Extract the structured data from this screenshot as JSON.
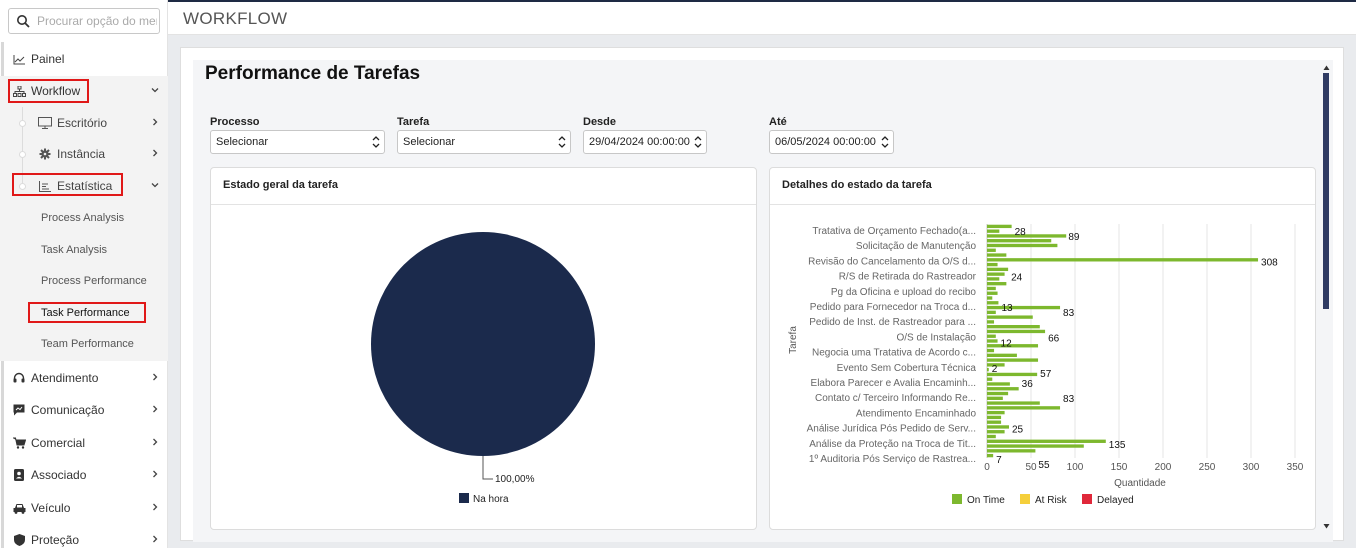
{
  "search": {
    "placeholder": "Procurar opção do menu"
  },
  "sidebar": {
    "painel": "Painel",
    "workflow": "Workflow",
    "escritorio": "Escritório",
    "instancia": "Instância",
    "estatistica": "Estatística",
    "leaves": [
      "Process Analysis",
      "Task Analysis",
      "Process Performance",
      "Task Performance",
      "Team Performance"
    ],
    "atendimento": "Atendimento",
    "comunicacao": "Comunicação",
    "comercial": "Comercial",
    "associado": "Associado",
    "veiculo": "Veículo",
    "protecao": "Proteção"
  },
  "header": {
    "title": "WORKFLOW"
  },
  "page": {
    "title": "Performance de Tarefas"
  },
  "filters": {
    "processo": {
      "label": "Processo",
      "value": "Selecionar"
    },
    "tarefa": {
      "label": "Tarefa",
      "value": "Selecionar"
    },
    "desde": {
      "label": "Desde",
      "value": "29/04/2024 00:00:00"
    },
    "ate": {
      "label": "Até",
      "value": "06/05/2024 00:00:00"
    }
  },
  "colors": {
    "on_time": "#7db82e",
    "at_risk": "#f5cf3b",
    "delayed": "#e0283a",
    "pie": "#1b2a4c",
    "accent": "#2f3b63"
  },
  "chart_data": [
    {
      "type": "pie",
      "title": "Estado geral da tarefa",
      "slices": [
        {
          "name": "Na hora",
          "value": 100,
          "label": "100,00%",
          "color": "#1b2a4c"
        }
      ],
      "legend": [
        "Na hora"
      ]
    },
    {
      "type": "bar",
      "orientation": "horizontal",
      "title": "Detalhes do estado da tarefa",
      "xlabel": "Quantidade",
      "ylabel": "Tarefa",
      "xlim": [
        0,
        350
      ],
      "xticks": [
        0,
        50,
        100,
        150,
        200,
        250,
        300,
        350
      ],
      "grid": true,
      "legend_position": "bottom",
      "category_labels": [
        "Tratativa de Orçamento Fechado(a...",
        "Solicitação de Manutenção",
        "Revisão do Cancelamento da O/S d...",
        "R/S de Retirada do Rastreador",
        "Pg da Oficina e upload do recibo",
        "Pedido para Fornecedor na Troca d...",
        "Pedido de Inst. de Rastreador para ...",
        "O/S de Instalação",
        "Negocia uma Tratativa de Acordo c...",
        "Evento Sem Cobertura Técnica",
        "Elabora Parecer e Avalia Encaminh...",
        "Contato c/ Terceiro Informando Re...",
        "Atendimento Encaminhado",
        "Análise Jurídica Pós Pedido de Serv...",
        "Análise da Proteção na Troca de Tit...",
        "1º Auditoria Pós Serviço de Rastrea..."
      ],
      "series": [
        {
          "name": "On Time",
          "color": "#7db82e",
          "values": [
            28,
            14,
            90,
            73,
            80,
            10,
            22,
            308,
            12,
            24,
            20,
            14,
            22,
            10,
            12,
            6,
            13,
            83,
            10,
            52,
            8,
            60,
            66,
            10,
            12,
            58,
            8,
            34,
            58,
            20,
            2,
            57,
            6,
            26,
            36,
            24,
            18,
            60,
            83,
            20,
            16,
            16,
            25,
            20,
            10,
            135,
            110,
            55,
            7
          ]
        },
        {
          "name": "At Risk",
          "color": "#f5cf3b",
          "values": []
        },
        {
          "name": "Delayed",
          "color": "#e0283a",
          "values": []
        }
      ],
      "data_labels": [
        {
          "value": "28",
          "near": "Tratativa de Orçamento Fechado(a..."
        },
        {
          "value": "89",
          "near": "Tratativa de Orçamento Fechado(a..."
        },
        {
          "value": "308",
          "near": "Revisão do Cancelamento da O/S d..."
        },
        {
          "value": "24",
          "near": "R/S de Retirada do Rastreador"
        },
        {
          "value": "13",
          "near": "Pedido para Fornecedor na Troca d..."
        },
        {
          "value": "83",
          "near": "Pedido para Fornecedor na Troca d..."
        },
        {
          "value": "66",
          "near": "O/S de Instalação"
        },
        {
          "value": "12",
          "near": "O/S de Instalação"
        },
        {
          "value": "2",
          "near": "Evento Sem Cobertura Técnica"
        },
        {
          "value": "57",
          "near": "Evento Sem Cobertura Técnica"
        },
        {
          "value": "36",
          "near": "Elabora Parecer e Avalia Encaminh..."
        },
        {
          "value": "83",
          "near": "Contato c/ Terceiro Informando Re..."
        },
        {
          "value": "25",
          "near": "Análise Jurídica Pós Pedido de Serv..."
        },
        {
          "value": "135",
          "near": "Análise da Proteção na Troca de Tit..."
        },
        {
          "value": "7",
          "near": "1º Auditoria Pós Serviço de Rastrea..."
        },
        {
          "value": "55",
          "near": "1º Auditoria Pós Serviço de Rastrea..."
        }
      ],
      "legend": [
        "On Time",
        "At Risk",
        "Delayed"
      ]
    }
  ]
}
